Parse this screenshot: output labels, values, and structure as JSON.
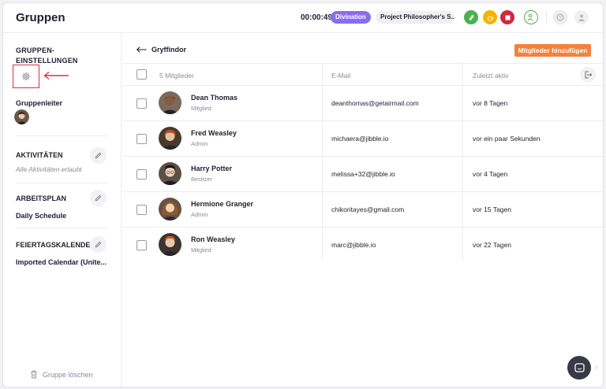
{
  "header": {
    "title": "Gruppen",
    "timer": "00:00:49",
    "activity": "Divination",
    "project": "Project Philosopher's S..."
  },
  "sidebar": {
    "settings_heading": "GRUPPEN-EINSTELLUNGEN",
    "leader_label": "Gruppenleiter",
    "activities_heading": "AKTIVITÄTEN",
    "activities_value": "Alle Aktivitäten erlaubt",
    "schedule_heading": "ARBEITSPLAN",
    "schedule_value": "Daily Schedule",
    "holiday_heading": "FEIERTAGSKALENDER",
    "holiday_value": "Imported Calendar (Unite...",
    "delete_label": "Gruppe löschen"
  },
  "main": {
    "group_name": "Gryffindor",
    "add_button": "Mitglieder hinzufügen",
    "columns": {
      "members": "5 Mitglieder",
      "email": "E-Mail",
      "last_active": "Zuletzt aktiv"
    },
    "rows": [
      {
        "name": "Dean Thomas",
        "role": "Mitglied",
        "email": "deanthomas@getairmail.com",
        "last": "vor 8 Tagen"
      },
      {
        "name": "Fred Weasley",
        "role": "Admin",
        "email": "michaera@jibble.io",
        "last": "vor ein paar Sekunden"
      },
      {
        "name": "Harry Potter",
        "role": "Besitzer",
        "email": "melissa+32@jibble.io",
        "last": "vor 4 Tagen"
      },
      {
        "name": "Hermione Granger",
        "role": "Admin",
        "email": "chikoritayes@gmail.com",
        "last": "vor 15 Tagen"
      },
      {
        "name": "Ron Weasley",
        "role": "Mitglied",
        "email": "marc@jibble.io",
        "last": "vor 22 Tagen"
      }
    ]
  },
  "colors": {
    "accent_orange": "#f5813a",
    "activity_purple": "#8a6cf0",
    "highlight_red": "#e0303a"
  }
}
